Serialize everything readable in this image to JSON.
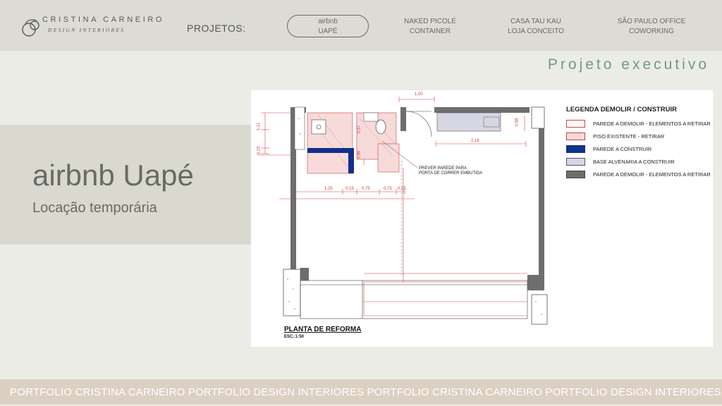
{
  "header": {
    "logo": {
      "name": "CRISTINA CARNEIRO",
      "subtitle": "DESIGN INTERIORES"
    },
    "projects_label": "PROJETOS:",
    "nav": [
      {
        "line1": "airbnb",
        "line2": "UAPÉ",
        "active": true
      },
      {
        "line1": "NAKED PICOLÉ",
        "line2": "CONTAINER",
        "active": false
      },
      {
        "line1": "CASA TAU KAU",
        "line2": "LOJA CONCEITO",
        "active": false
      },
      {
        "line1": "SÃO PAULO OFFICE",
        "line2": "COWORKING",
        "active": false
      }
    ]
  },
  "section_title": "Projeto executivo",
  "project": {
    "title": "airbnb Uapé",
    "subtitle": "Locação temporária"
  },
  "plan": {
    "legend_title": "LEGENDA DEMOLIR / CONSTRUIR",
    "legend": [
      {
        "label": "PAREDE A DEMOLIR - ELEMENTOS A RETIRAR",
        "color": "#ffffff",
        "border": "#d04040"
      },
      {
        "label": "PISO EXISTENTE - RETIRAR",
        "color": "#f7dada",
        "border": "#d04040"
      },
      {
        "label": "PAREDE A CONSTRUIR",
        "color": "#10308c",
        "border": "#10308c"
      },
      {
        "label": "BASE ALVENARIA A CONSTRUIR",
        "color": "#d6d6e4",
        "border": "#555555"
      },
      {
        "label": "PAREDE A DEMOLIR - ELEMENTOS A RETIRAR",
        "color": "#6e6e6e",
        "border": "#444444"
      }
    ],
    "note": [
      "PREVER PAREDE PARA",
      "PORTA DE CORRER EMBUTIDA"
    ],
    "title": "PLANTA DE REFORMA",
    "scale": "ESC.:1:50",
    "dimensions": [
      "1,00",
      "1,11",
      "0,15",
      "0,57",
      "0,86",
      "2,16",
      "0,58",
      "1,25",
      "0,15",
      "0,75",
      "0,75",
      "0,15"
    ]
  },
  "footer_text": "PORTFOLIO CRISTINA CARNEIRO PORTFOLIO DESIGN INTERIORES PORTFOLIO CRISTINA CARNEIRO PORTFOLIO DESIGN INTERIORES"
}
